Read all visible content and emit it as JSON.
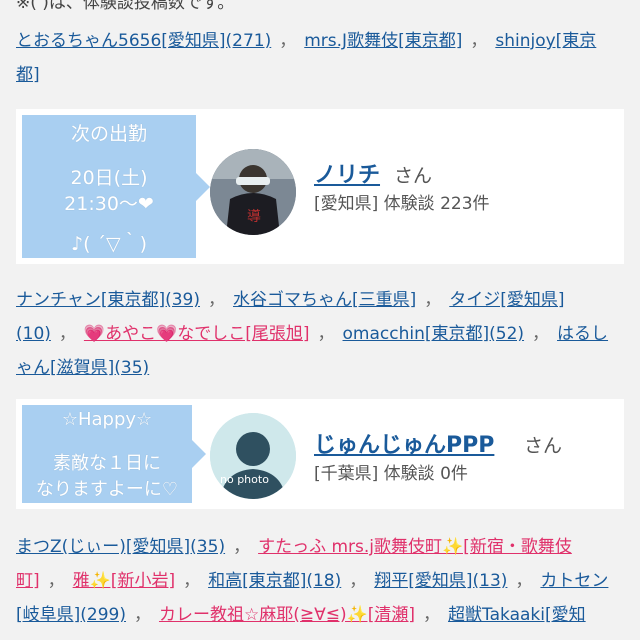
{
  "note": "※( )は、体験談投稿数です。",
  "list1": [
    {
      "text": "とおるちゃん5656[愛知県](271)",
      "pink": false
    },
    {
      "text": "mrs.J歌舞伎[東京都]",
      "pink": false
    },
    {
      "text": "shinjoy[東京都]",
      "pink": false
    }
  ],
  "card1": {
    "sched_title": "次の出勤",
    "sched_date": "20日(土)",
    "sched_time": "21:30〜❤",
    "sched_msg": "♪( ´▽｀)",
    "name": "ノリチ",
    "honorific": "さん",
    "meta": "[愛知県] 体験談 223件",
    "avatar": "user-photo"
  },
  "list2": [
    {
      "text": "ナンチャン[東京都](39)",
      "pink": false
    },
    {
      "text": "水谷ゴマちゃん[三重県]",
      "pink": false
    },
    {
      "text": "タイジ[愛知県](10)",
      "pink": false
    },
    {
      "text": "💗あやこ💗なでしこ[尾張旭]",
      "pink": true
    },
    {
      "text": "omacchin[東京都](52)",
      "pink": false
    },
    {
      "text": "はるしゃん[滋賀県](35)",
      "pink": false
    }
  ],
  "card2": {
    "sched_title": "☆Happy☆",
    "sched_line1": "素敵な１日に",
    "sched_line2": "なりますよーに♡",
    "name": "じゅんじゅんPPP",
    "honorific": "さん",
    "meta": "[千葉県] 体験談 0件",
    "avatar": "no-photo",
    "avatar_text": "no photo"
  },
  "list3": [
    {
      "text": "まつZ(じぃー)[愛知県](35)",
      "pink": false
    },
    {
      "text": "すたっふ mrs.j歌舞伎町✨[新宿・歌舞伎町]",
      "pink": true
    },
    {
      "text": "雅✨[新小岩]",
      "pink": true
    },
    {
      "text": "和高[東京都](18)",
      "pink": false
    },
    {
      "text": "翔平[愛知県](13)",
      "pink": false
    },
    {
      "text": "カトセン[岐阜県](299)",
      "pink": false
    },
    {
      "text": "カレー教祖☆麻耶(≧∀≦)✨[清瀬]",
      "pink": true
    },
    {
      "text": "超獣Takaaki[愛知",
      "pink": false
    }
  ],
  "colors": {
    "link": "#1a5a9a",
    "pink": "#e0316b",
    "sched_bg": "#a9cff1"
  }
}
